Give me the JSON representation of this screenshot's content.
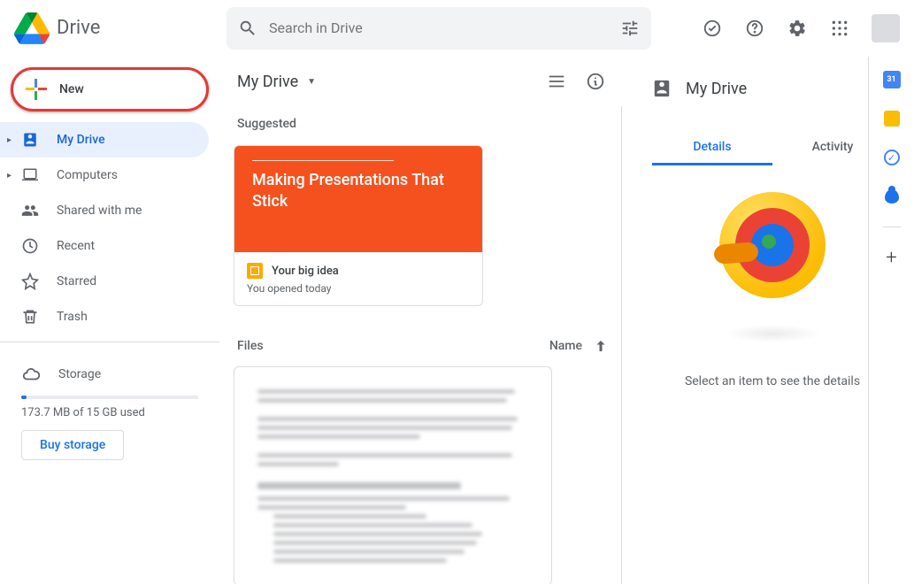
{
  "header": {
    "app_name": "Drive",
    "search_placeholder": "Search in Drive"
  },
  "sidebar": {
    "new_label": "New",
    "items": [
      {
        "label": "My Drive"
      },
      {
        "label": "Computers"
      },
      {
        "label": "Shared with me"
      },
      {
        "label": "Recent"
      },
      {
        "label": "Starred"
      },
      {
        "label": "Trash"
      }
    ],
    "storage_label": "Storage",
    "storage_text": "173.7 MB of 15 GB used",
    "buy_label": "Buy storage"
  },
  "main": {
    "breadcrumb": "My Drive",
    "suggested_label": "Suggested",
    "suggested": {
      "thumb_text": "Making Presentations That Stick",
      "title": "Your big idea",
      "subtitle": "You opened today"
    },
    "files_label": "Files",
    "sort_label": "Name"
  },
  "details": {
    "title": "My Drive",
    "tabs": {
      "details": "Details",
      "activity": "Activity"
    },
    "empty_message": "Select an item to see the details"
  }
}
